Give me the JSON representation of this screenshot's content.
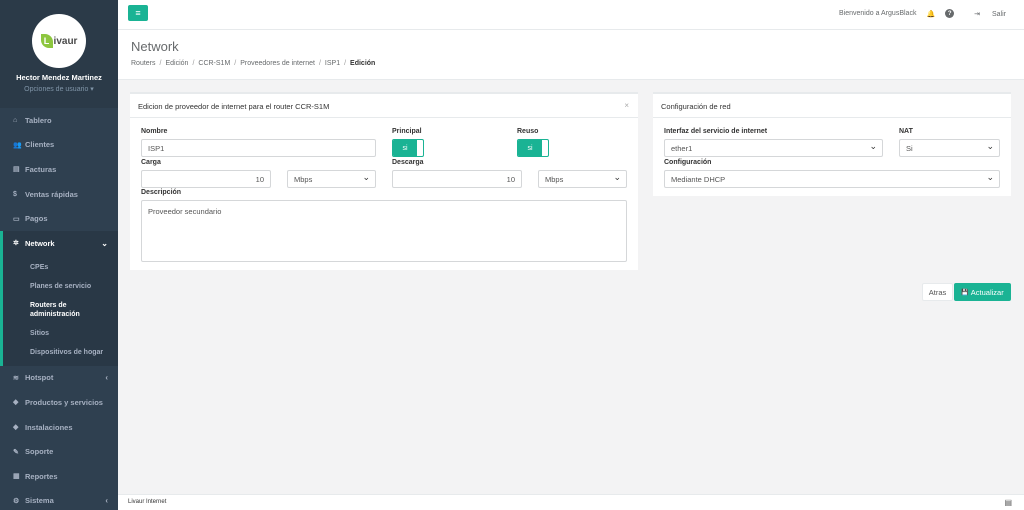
{
  "profile": {
    "logo_text": "ivaur",
    "logo_leaf": "L",
    "name": "Hector Mendez Martinez",
    "options": "Opciones de usuario ▾"
  },
  "sidebar": {
    "items": [
      {
        "icon": "⌂",
        "label": "Tablero"
      },
      {
        "icon": "👥",
        "label": "Clientes"
      },
      {
        "icon": "▤",
        "label": "Facturas"
      },
      {
        "icon": "$",
        "label": "Ventas rápidas"
      },
      {
        "icon": "▭",
        "label": "Pagos"
      },
      {
        "icon": "✲",
        "label": "Network",
        "arrow": "⌄"
      },
      {
        "icon": "≋",
        "label": "Hotspot",
        "arrow": "‹"
      },
      {
        "icon": "◆",
        "label": "Productos y servicios"
      },
      {
        "icon": "◆",
        "label": "Instalaciones"
      },
      {
        "icon": "✎",
        "label": "Soporte"
      },
      {
        "icon": "▦",
        "label": "Reportes"
      },
      {
        "icon": "⚙",
        "label": "Sistema",
        "arrow": "‹"
      }
    ],
    "network_sub": [
      "CPEs",
      "Planes de servicio",
      "Routers de administración",
      "Sitios",
      "Dispositivos de hogar"
    ]
  },
  "topbar": {
    "menu_icon": "≡",
    "welcome": "Bienvenido a ArgusBlack",
    "bell": "🔔",
    "help": "?",
    "logout_icon": "⇥",
    "logout": "Salir"
  },
  "heading": {
    "title": "Network",
    "breadcrumb": [
      "Routers",
      "Edición",
      "CCR-S1M",
      "Proveedores de internet",
      "ISP1",
      "Edición"
    ]
  },
  "provider_panel": {
    "title": "Edicion de proveedor de internet para el router CCR-S1M",
    "close": "×",
    "nombre_label": "Nombre",
    "nombre_value": "ISP1",
    "principal_label": "Principal",
    "principal_value": "si",
    "reuso_label": "Reuso",
    "reuso_value": "si",
    "carga_label": "Carga",
    "carga_value": "10",
    "carga_unit": "Mbps",
    "descarga_label": "Descarga",
    "descarga_value": "10",
    "descarga_unit": "Mbps",
    "descripcion_label": "Descripción",
    "descripcion_value": "Proveedor secundario"
  },
  "network_panel": {
    "title": "Configuración de red",
    "interfaz_label": "Interfaz del servicio de internet",
    "interfaz_value": "ether1",
    "nat_label": "NAT",
    "nat_value": "Si",
    "config_label": "Configuración",
    "config_value": "Mediante DHCP"
  },
  "actions": {
    "back": "Atras",
    "update": "Actualizar",
    "update_icon": "💾"
  },
  "footer": {
    "text": "Livaur Internet",
    "icon": "▤"
  },
  "colors": {
    "accent": "#1ab394",
    "sidebar": "#2f4050"
  }
}
